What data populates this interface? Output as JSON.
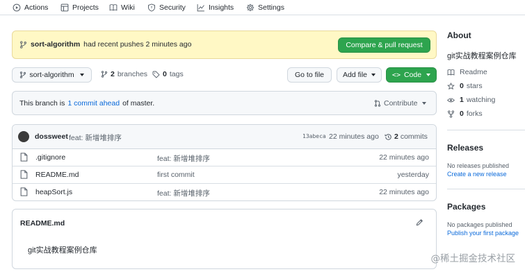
{
  "nav": {
    "actions": "Actions",
    "projects": "Projects",
    "wiki": "Wiki",
    "security": "Security",
    "insights": "Insights",
    "settings": "Settings"
  },
  "banner": {
    "branch": "sort-algorithm",
    "text": "had recent pushes 2 minutes ago",
    "button": "Compare & pull request"
  },
  "branch_bar": {
    "branch_select": "sort-algorithm",
    "branches_count": "2",
    "branches_label": "branches",
    "tags_count": "0",
    "tags_label": "tags",
    "go_to_file": "Go to file",
    "add_file": "Add file",
    "code": "Code"
  },
  "ahead": {
    "prefix": "This branch is",
    "link": "1 commit ahead",
    "suffix": "of master.",
    "contribute": "Contribute"
  },
  "latest_commit": {
    "author": "dossweet",
    "message": "feat: 新增堆排序",
    "sha": "13abeca",
    "age": "22 minutes ago",
    "commits_count": "2",
    "commits_label": "commits"
  },
  "files": [
    {
      "name": ".gitignore",
      "message": "feat: 新增堆排序",
      "age": "22 minutes ago"
    },
    {
      "name": "README.md",
      "message": "first commit",
      "age": "yesterday"
    },
    {
      "name": "heapSort.js",
      "message": "feat: 新增堆排序",
      "age": "22 minutes ago"
    }
  ],
  "readme": {
    "title": "README.md",
    "content": "git实战教程案例仓库"
  },
  "sidebar": {
    "about_title": "About",
    "description": "git实战教程案例仓库",
    "readme": "Readme",
    "stars_count": "0",
    "stars_label": "stars",
    "watching_count": "1",
    "watching_label": "watching",
    "forks_count": "0",
    "forks_label": "forks",
    "releases_title": "Releases",
    "releases_none": "No releases published",
    "releases_link": "Create a new release",
    "packages_title": "Packages",
    "packages_none": "No packages published",
    "packages_link": "Publish your first package"
  },
  "watermark": "@稀土掘金技术社区"
}
